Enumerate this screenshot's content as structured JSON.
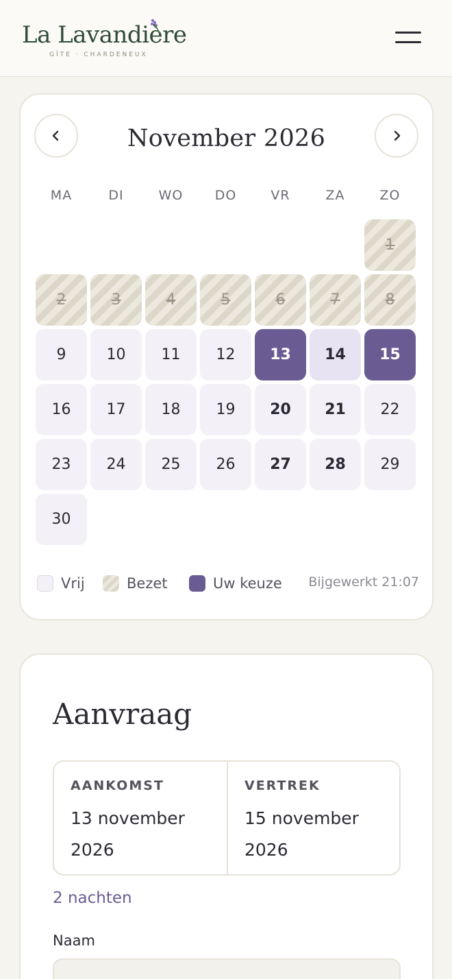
{
  "header": {
    "logo_title": "La Lavandière",
    "logo_subtitle": "GÎTE · CHARDENEUX",
    "menu_icon": "hamburger-menu-icon"
  },
  "calendar": {
    "month_title": "November 2026",
    "prev_icon": "chevron-left-icon",
    "next_icon": "chevron-right-icon",
    "weekdays": [
      "MA",
      "DI",
      "WO",
      "DO",
      "VR",
      "ZA",
      "ZO"
    ],
    "days": [
      {
        "label": "1",
        "status": "booked"
      },
      {
        "label": "2",
        "status": "booked"
      },
      {
        "label": "3",
        "status": "booked"
      },
      {
        "label": "4",
        "status": "booked"
      },
      {
        "label": "5",
        "status": "booked"
      },
      {
        "label": "6",
        "status": "booked"
      },
      {
        "label": "7",
        "status": "booked"
      },
      {
        "label": "8",
        "status": "booked"
      },
      {
        "label": "9",
        "status": "free"
      },
      {
        "label": "10",
        "status": "free"
      },
      {
        "label": "11",
        "status": "free"
      },
      {
        "label": "12",
        "status": "free"
      },
      {
        "label": "13",
        "status": "selected"
      },
      {
        "label": "14",
        "status": "range"
      },
      {
        "label": "15",
        "status": "selected"
      },
      {
        "label": "16",
        "status": "free"
      },
      {
        "label": "17",
        "status": "free"
      },
      {
        "label": "18",
        "status": "free"
      },
      {
        "label": "19",
        "status": "free"
      },
      {
        "label": "20",
        "status": "weekend"
      },
      {
        "label": "21",
        "status": "weekend"
      },
      {
        "label": "22",
        "status": "free"
      },
      {
        "label": "23",
        "status": "free"
      },
      {
        "label": "24",
        "status": "free"
      },
      {
        "label": "25",
        "status": "free"
      },
      {
        "label": "26",
        "status": "free"
      },
      {
        "label": "27",
        "status": "weekend"
      },
      {
        "label": "28",
        "status": "weekend"
      },
      {
        "label": "29",
        "status": "free"
      },
      {
        "label": "30",
        "status": "free"
      }
    ],
    "legend": {
      "free": "Vrij",
      "booked": "Bezet",
      "choice": "Uw keuze",
      "updated": "Bijgewerkt 21:07"
    },
    "colors": {
      "accent": "#6b5b93",
      "free": "#f3f1f7",
      "range": "#e7e3f3",
      "booked_stripe": "#ddd7c9"
    }
  },
  "request": {
    "title": "Aanvraag",
    "arrival_label": "AANKOMST",
    "arrival_value": "13 november 2026",
    "departure_label": "VERTREK",
    "departure_value": "15 november 2026",
    "nights": "2 nachten",
    "name_label": "Naam",
    "name_value": ""
  }
}
